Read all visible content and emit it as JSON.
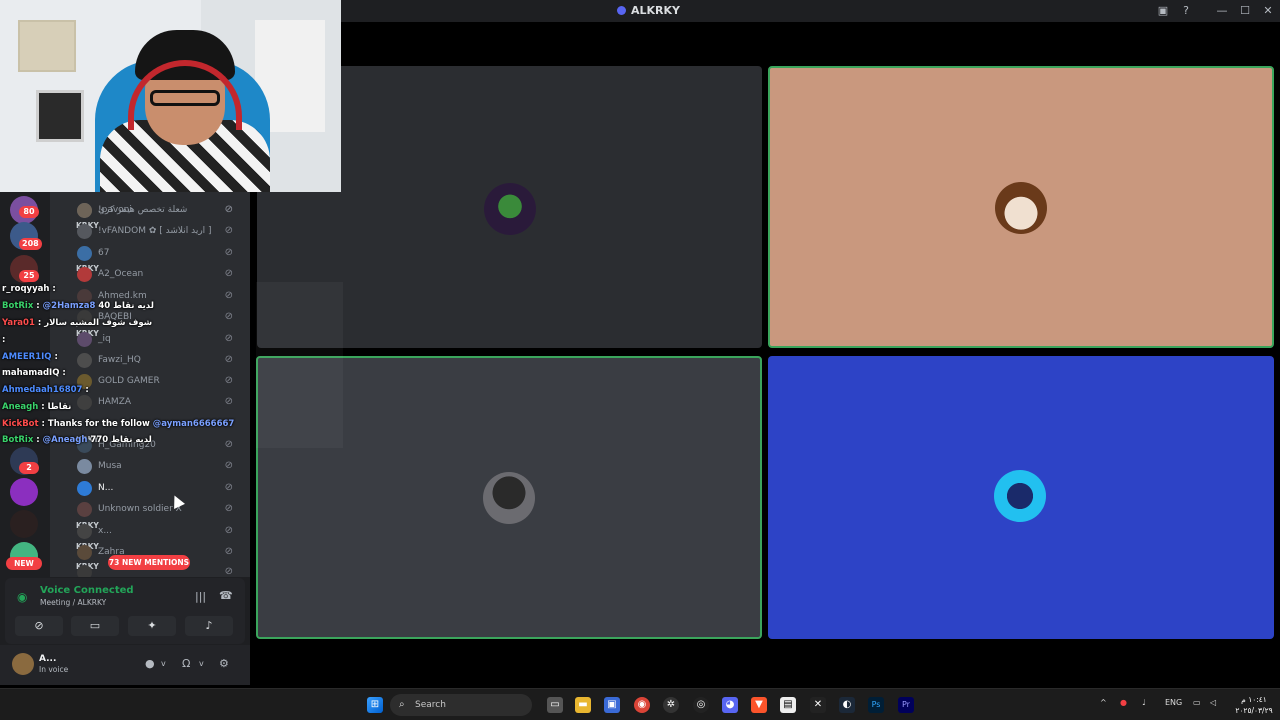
{
  "window": {
    "title": "ALKRKY",
    "controls": {
      "minimize": "—",
      "maximize": "☐",
      "close": "✕"
    }
  },
  "servers": {
    "badges": [
      "80",
      "208",
      "25",
      "2"
    ],
    "new_label": "NEW"
  },
  "members": [
    {
      "name": "شعلة تخصص هيمر كري",
      "badge": ""
    },
    {
      "name": "!pavoni",
      "badge": ""
    },
    {
      "name": "!vFANDOM ✿ [ اريد انلاشد ]",
      "badge": "KRKY"
    },
    {
      "name": "67",
      "badge": ""
    },
    {
      "name": "A2_Ocean",
      "badge": "KRKY"
    },
    {
      "name": "Ahmed.km",
      "badge": ""
    },
    {
      "name": "BAQEBI",
      "badge": ""
    },
    {
      "name": "_iq",
      "badge": "KRKY"
    },
    {
      "name": "Fawzi_HQ",
      "badge": ""
    },
    {
      "name": "GOLD GAMER",
      "badge": ""
    },
    {
      "name": "HAMZA",
      "badge": ""
    },
    {
      "name": "H_Gaming20",
      "badge": "KRKY"
    },
    {
      "name": "Musa",
      "badge": ""
    },
    {
      "name": "N...",
      "badge": ""
    },
    {
      "name": "Unknown soldier X",
      "badge": ""
    },
    {
      "name": "x...",
      "badge": "KRKY"
    },
    {
      "name": "Zahra",
      "badge": "KRKY"
    },
    {
      "name": "",
      "badge": "KRKY"
    }
  ],
  "new_mentions": "73 NEW MENTIONS",
  "chat": [
    {
      "user": "r_roqyyah",
      "sep": " : ",
      "msg": ""
    },
    {
      "user": "BotRix",
      "sep": " : ",
      "mention": "@2Hamza8",
      "msg": " لديه نقاط 40"
    },
    {
      "user": "Yara01",
      "sep": " : ",
      "msg": "شوف شوف المشبه سالار"
    },
    {
      "user": "",
      "sep": " : ",
      "msg": ""
    },
    {
      "user": "AMEER1IQ",
      "sep": " : ",
      "msg": ""
    },
    {
      "user": "mahamadIQ",
      "sep": " : ",
      "msg": ""
    },
    {
      "user": "Ahmedaah16807",
      "sep": " : ",
      "msg": ""
    },
    {
      "user": "Aneagh",
      "sep": " : ",
      "msg": "نقاطا"
    },
    {
      "user": "KickBot",
      "sep": " : ",
      "msg": "Thanks for the follow ",
      "mention": "@ayman6666667"
    },
    {
      "user": "BotRix",
      "sep": " : ",
      "mention": "@Aneagh",
      "msg": " لديه نقاط 770"
    }
  ],
  "voice": {
    "status": "Voice Connected",
    "channel": "Meeting / ALKRKY"
  },
  "user": {
    "name": "A...",
    "status": "In voice"
  },
  "taskbar": {
    "search_placeholder": "Search",
    "lang": "ENG",
    "time": "١٠:٤١ م",
    "date": "٢٠٢٥/٠٣/٢٩"
  },
  "colors": {
    "tile_dark": "#2b2d31",
    "tile_peach": "#c9987e",
    "tile_gray": "#3a3d43",
    "tile_blue": "#2d43c6",
    "speaking_border": "#3ba55c"
  }
}
